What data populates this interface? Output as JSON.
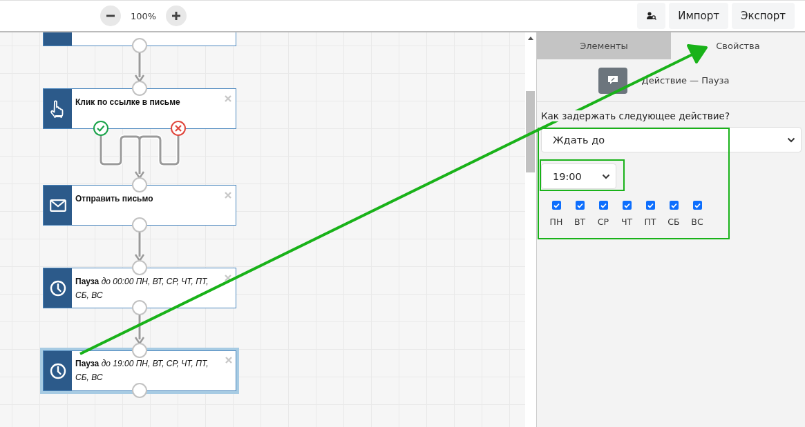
{
  "toolbar": {
    "zoom": "100%",
    "buttons": [
      "Импорт",
      "Экспорт"
    ]
  },
  "canvas": {
    "nodes": [
      {
        "kind": "clipped",
        "selected": false
      },
      {
        "kind": "click",
        "title": "Клик по ссылке в письме",
        "selected": false
      },
      {
        "kind": "email",
        "title": "Отправить письмо",
        "selected": false
      },
      {
        "kind": "pause",
        "title": "Пауза",
        "detail": "до 00:00 ПН, ВТ, СР, ЧТ, ПТ, СБ, ВС",
        "selected": false
      },
      {
        "kind": "pause",
        "title": "Пауза",
        "detail": "до 19:00 ПН, ВТ, СР, ЧТ, ПТ, СБ, ВС",
        "selected": true
      }
    ]
  },
  "panel": {
    "tabs": [
      {
        "label": "Элементы",
        "selected": false
      },
      {
        "label": "Свойства",
        "selected": true
      }
    ],
    "heading": "Действие — Пауза",
    "question": "Как задержать следующее действие?",
    "mode_select": {
      "value": "Ждать до"
    },
    "time_select": {
      "value": "19:00"
    },
    "days": [
      {
        "label": "ПН",
        "checked": true
      },
      {
        "label": "ВТ",
        "checked": true
      },
      {
        "label": "СР",
        "checked": true
      },
      {
        "label": "ЧТ",
        "checked": true
      },
      {
        "label": "ПТ",
        "checked": true
      },
      {
        "label": "СБ",
        "checked": true
      },
      {
        "label": "ВС",
        "checked": true
      }
    ]
  }
}
